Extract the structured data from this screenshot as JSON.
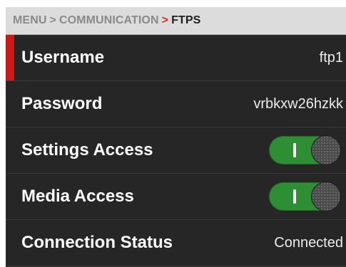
{
  "breadcrumb": {
    "menu": "MENU",
    "separator": ">",
    "section": "COMMUNICATION",
    "active_separator": ">",
    "current": "FTPS"
  },
  "rows": [
    {
      "label": "Username",
      "value": "ftp1"
    },
    {
      "label": "Password",
      "value": "vrbkxw26hzkk"
    },
    {
      "label": "Settings Access",
      "toggle": "on"
    },
    {
      "label": "Media Access",
      "toggle": "on"
    },
    {
      "label": "Connection Status",
      "value": "Connected"
    }
  ],
  "colors": {
    "accent": "#cc1a17",
    "toggle_on": "#2e8e34",
    "background": "#262626",
    "header": "#dcdcdc"
  }
}
